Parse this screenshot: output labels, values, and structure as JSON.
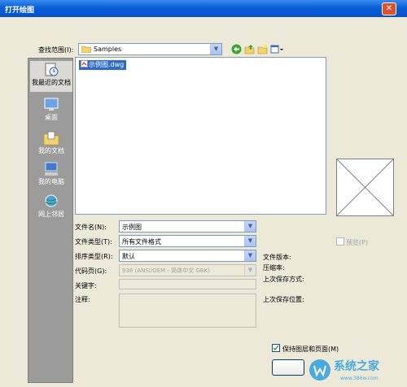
{
  "window": {
    "title": "打开绘图",
    "close_glyph": "✕"
  },
  "lookin": {
    "label": "查找范围(I):",
    "value": "Samples"
  },
  "places": [
    {
      "label": "我最近的文档",
      "icon": "recent-documents-icon",
      "selected": true
    },
    {
      "label": "桌面",
      "icon": "desktop-icon",
      "selected": false
    },
    {
      "label": "我的文档",
      "icon": "my-documents-icon",
      "selected": false
    },
    {
      "label": "我的电脑",
      "icon": "my-computer-icon",
      "selected": false
    },
    {
      "label": "网上邻居",
      "icon": "network-places-icon",
      "selected": false
    }
  ],
  "files": [
    {
      "name": "示例图.dwg",
      "selected": true
    }
  ],
  "filename": {
    "label": "文件名(N):",
    "value": "示例图"
  },
  "filetype": {
    "label": "文件类型(T):",
    "value": "所有文件格式"
  },
  "sorttype": {
    "label": "排序类型(R):",
    "value": "默认"
  },
  "codepage": {
    "label": "代码页(G):",
    "value": "936 (ANSI/OEM - 简体中文 GBK)"
  },
  "keywords": {
    "label": "关键字:",
    "value": ""
  },
  "comments": {
    "label": "注释:",
    "value": ""
  },
  "preview": {
    "checkbox_label": "预览(P)",
    "checked": false
  },
  "fileinfo": {
    "version_label": "文件版本:",
    "compression_label": "压缩率:",
    "last_save_method_label": "上次保存方式:",
    "last_save_location_label": "上次保存位置:"
  },
  "keep_layout": {
    "label": "保持图层和页面(M)",
    "checked": true
  },
  "watermark": {
    "text": "系统之家",
    "url": "www.386w.com"
  },
  "colors": {
    "title_bar": "#0a5fd8",
    "face": "#ece9d8",
    "selection": "#316ac5",
    "places_bg": "#9b9b9b"
  }
}
